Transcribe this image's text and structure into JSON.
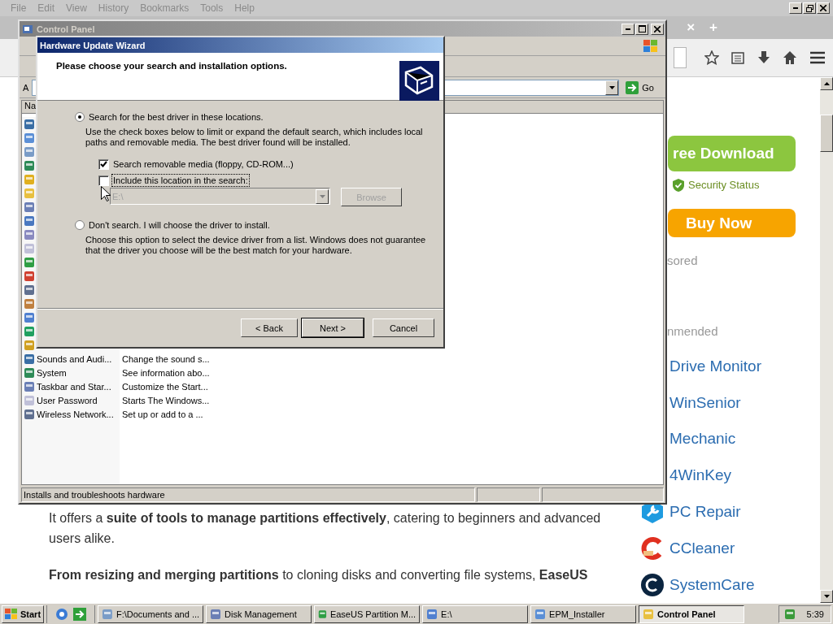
{
  "browser": {
    "menu": [
      "File",
      "Edit",
      "View",
      "History",
      "Bookmarks",
      "Tools",
      "Help"
    ],
    "tab_close": "×",
    "new_tab": "+",
    "sidebar": {
      "buttons": [
        {
          "kind": "download",
          "label": "ree Download"
        },
        {
          "kind": "buy",
          "label": "Buy Now"
        }
      ],
      "security_status": "Security Status",
      "sponsored_heading": "sored",
      "recommended_heading": "nmended",
      "links": [
        {
          "kind": "plain",
          "label": "Drive Monitor"
        },
        {
          "kind": "plain",
          "label": "WinSenior"
        },
        {
          "kind": "plain",
          "label": "Mechanic"
        },
        {
          "kind": "plain",
          "label": "4WinKey"
        },
        {
          "kind": "repair",
          "label": "PC Repair"
        },
        {
          "kind": "cleaner",
          "label": "CCleaner"
        },
        {
          "kind": "care",
          "label": "SystemCare"
        }
      ]
    },
    "article": {
      "paragraphs": [
        "It offers a **suite of tools to manage partitions effectively**, catering to beginners and advanced users alike.",
        "**From resizing and merging partitions** to cloning disks and converting file systems, **EaseUS**"
      ]
    }
  },
  "control_panel": {
    "title": "Control Panel",
    "address_label": "A",
    "go": "Go",
    "column_header": "Na",
    "items": [
      {
        "name": "Sounds and Audi...",
        "description": "Change the sound s..."
      },
      {
        "name": "System",
        "description": "See information abo..."
      },
      {
        "name": "Taskbar and Star...",
        "description": "Customize the Start..."
      },
      {
        "name": "User Password",
        "description": "Starts The Windows..."
      },
      {
        "name": "Wireless Network...",
        "description": "Set up or add to a ..."
      }
    ],
    "status_bar": "Installs and troubleshoots hardware"
  },
  "wizard": {
    "title": "Hardware Update Wizard",
    "heading": "Please choose your search and installation options.",
    "options": [
      {
        "label": "Search for the best driver in these locations.",
        "description": "Use the check boxes below to limit or expand the default search, which includes local paths and removable media. The best driver found will be installed.",
        "selected": true
      },
      {
        "label": "Don't search. I will choose the driver to install.",
        "description": "Choose this option to select the device driver from a list.  Windows does not guarantee that the driver you choose will be the best match for your hardware.",
        "selected": false
      }
    ],
    "checkboxes": [
      {
        "label": "Search removable media (floppy, CD-ROM...)",
        "checked": true,
        "focused": false
      },
      {
        "label": "Include this location in the search:",
        "checked": false,
        "focused": true
      }
    ],
    "location": {
      "value": "E:\\",
      "disabled": true
    },
    "browse": {
      "label": "Browse",
      "disabled": true
    },
    "buttons": [
      {
        "label": "< Back",
        "default": false
      },
      {
        "label": "Next >",
        "default": true
      },
      {
        "label": "Cancel",
        "default": false
      }
    ]
  },
  "taskbar": {
    "start": "Start",
    "tasks": [
      {
        "label": "F:\\Documents and ...",
        "selected": false
      },
      {
        "label": "Disk Management",
        "selected": false
      },
      {
        "label": "EaseUS Partition M...",
        "selected": false
      },
      {
        "label": "E:\\",
        "selected": false
      },
      {
        "label": "EPM_Installer",
        "selected": false
      },
      {
        "label": "Control Panel",
        "selected": true
      }
    ],
    "clock": "5:39"
  }
}
